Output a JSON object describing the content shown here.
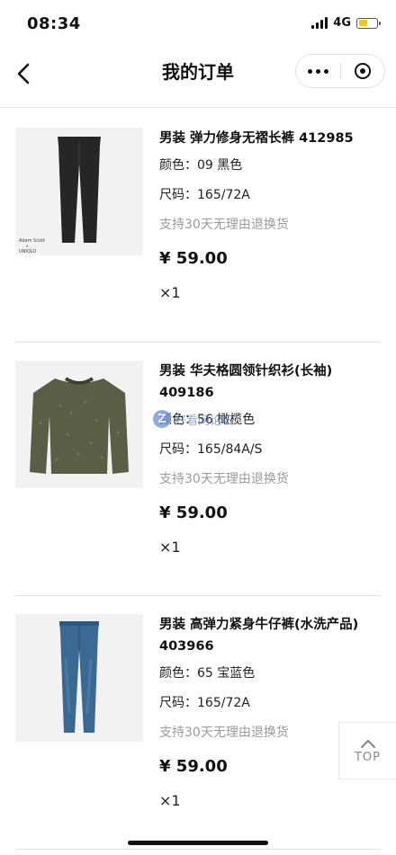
{
  "status_bar": {
    "time": "08:34",
    "network": "4G",
    "battery_level": 0.45
  },
  "nav": {
    "title": "我的订单"
  },
  "orders": [
    {
      "name": "男装 弹力修身无褶长裤 412985",
      "color": "颜色：09 黑色",
      "size": "尺码：165/72A",
      "policy": "支持30天无理由退换货",
      "price": "¥ 59.00",
      "quantity": "×1",
      "image_brand_text": "Adam Scott x UNIQLO"
    },
    {
      "name": "男装 华夫格圆领针织衫(长袖) 409186",
      "color": "颜色：56 橄榄色",
      "size": "尺码：165/84A/S",
      "policy": "支持30天无理由退换货",
      "price": "¥ 59.00",
      "quantity": "×1"
    },
    {
      "name": "男装 高弹力紧身牛仔裤(水洗产品) 403966",
      "color": "颜色：65 宝蓝色",
      "size": "尺码：165/72A",
      "policy": "支持30天无理由退换货",
      "price": "¥ 59.00",
      "quantity": "×1"
    }
  ],
  "top_button": {
    "label": "TOP"
  },
  "watermark": "好看网论坛",
  "colors": {
    "divider": "#e2e2e2",
    "muted_text": "#9a9a9a",
    "battery": "#f5c518",
    "pants_black": "#262626",
    "sweater_olive": "#5a5e44",
    "jeans_blue": "#3a6a94"
  },
  "icons": {
    "back": "chevron-left-icon",
    "more": "more-dots-icon",
    "close_miniprogram": "target-circle-icon",
    "top": "chevron-up-icon"
  }
}
